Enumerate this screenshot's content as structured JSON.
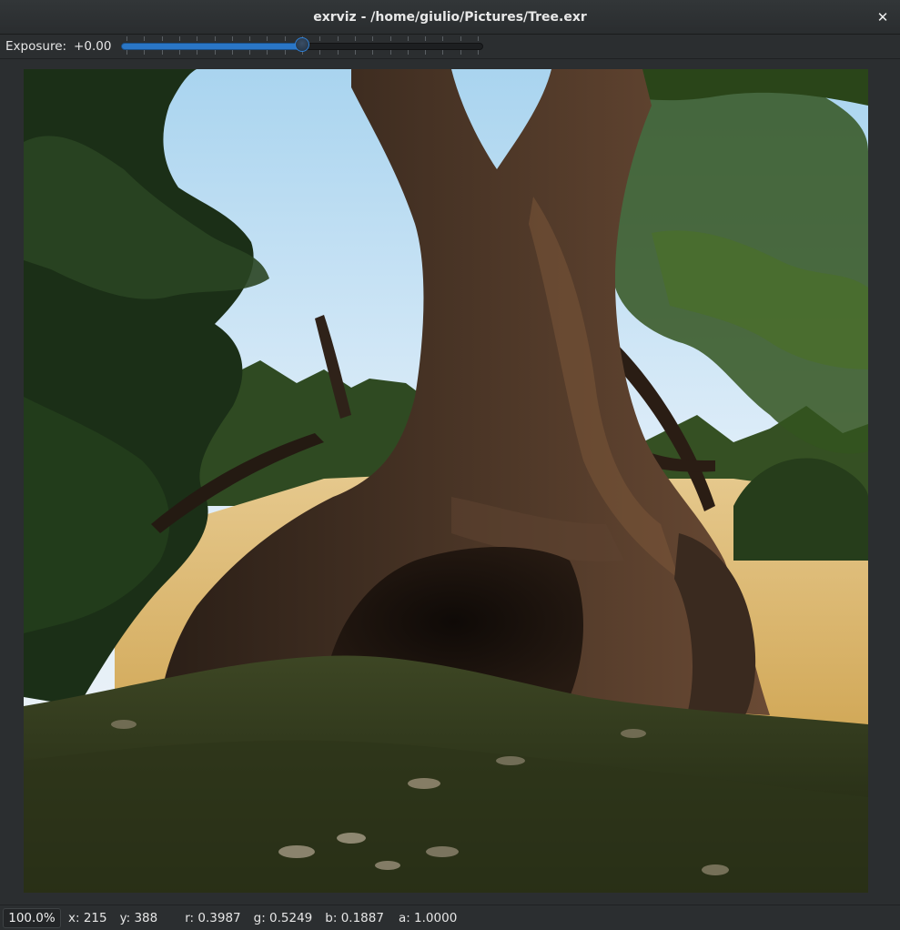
{
  "window": {
    "title": "exrviz - /home/giulio/Pictures/Tree.exr",
    "close_icon": "close-icon"
  },
  "toolbar": {
    "exposure_label": "Exposure:",
    "exposure_value": "+0.00",
    "exposure_slider_fraction": 0.5
  },
  "viewer": {
    "image_subject": "Tree.exr"
  },
  "status": {
    "zoom": "100.0%",
    "x": "x: 215",
    "y": "y: 388",
    "r": "r: 0.3987",
    "g": "g: 0.5249",
    "b": "b: 0.1887",
    "a": "a: 1.0000"
  },
  "colors": {
    "accent": "#2a76c6",
    "window_bg": "#2b2e30"
  }
}
